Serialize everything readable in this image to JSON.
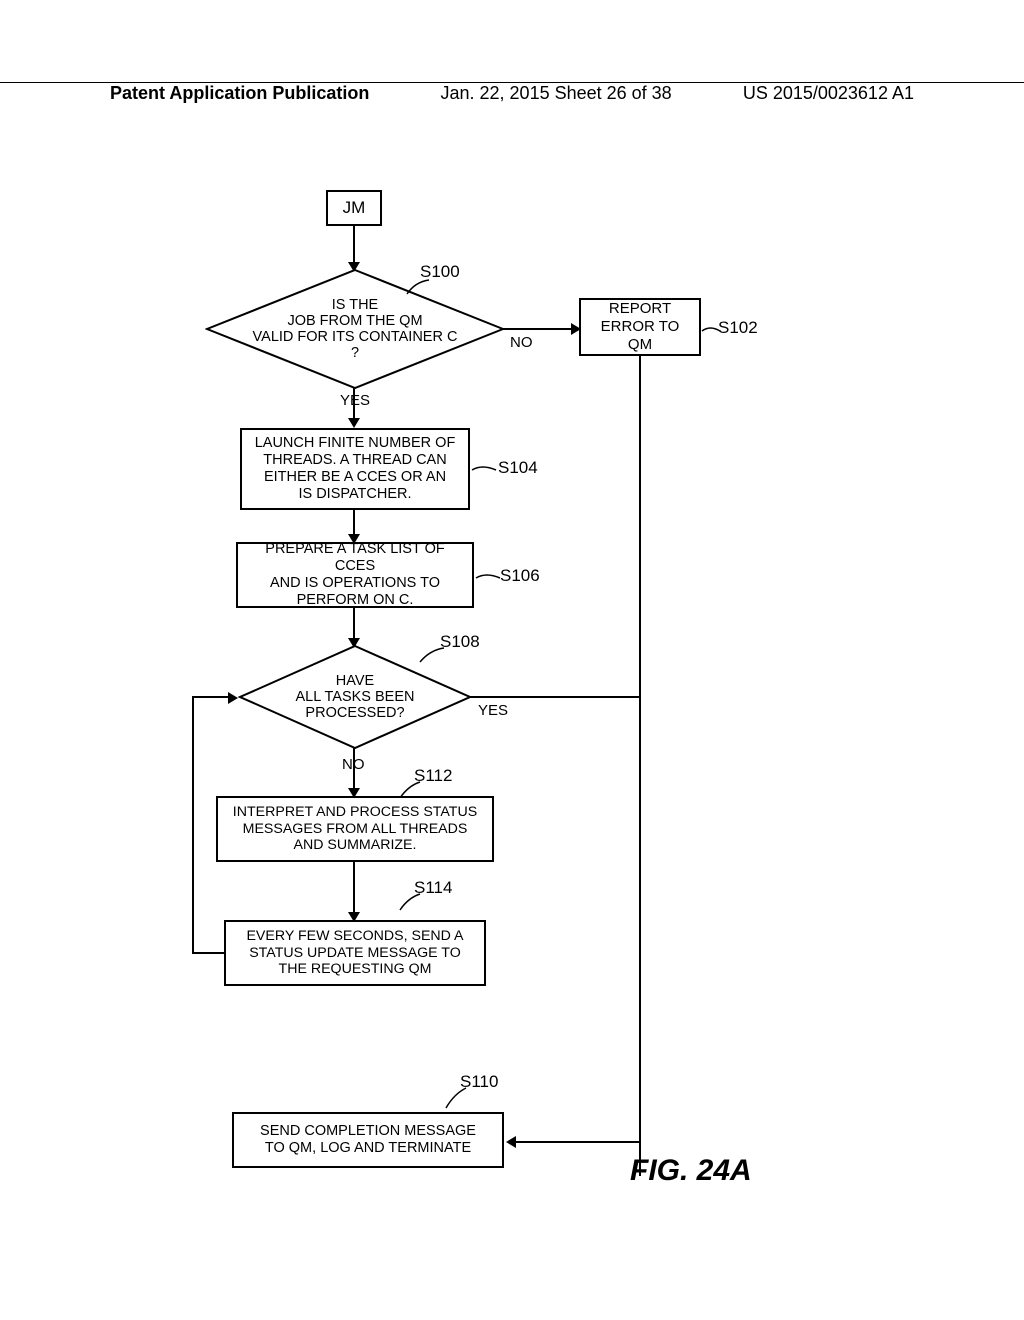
{
  "header": {
    "left": "Patent Application Publication",
    "mid": "Jan. 22, 2015  Sheet 26 of 38",
    "right": "US 2015/0023612 A1"
  },
  "figure_title": "FIG. 24A",
  "nodes": {
    "jm": "JM",
    "d1": "IS THE\nJOB FROM THE QM\nVALID FOR ITS CONTAINER C\n?",
    "report_error": "REPORT\nERROR TO QM",
    "launch_threads": "LAUNCH FINITE NUMBER OF\nTHREADS. A THREAD CAN\nEITHER BE A CCES OR AN\nIS DISPATCHER.",
    "prepare_tasks": "PREPARE A TASK LIST OF CCES\nAND IS OPERATIONS TO\nPERFORM ON C.",
    "d2": "HAVE\nALL TASKS BEEN\nPROCESSED?",
    "interpret": "INTERPRET AND PROCESS STATUS\nMESSAGES FROM ALL THREADS\nAND SUMMARIZE.",
    "status_update": "EVERY FEW SECONDS, SEND A\nSTATUS UPDATE MESSAGE TO\nTHE REQUESTING QM",
    "completion": "SEND COMPLETION MESSAGE\nTO QM, LOG AND TERMINATE"
  },
  "labels": {
    "yes": "YES",
    "no": "NO"
  },
  "steps": {
    "s100": "S100",
    "s102": "S102",
    "s104": "S104",
    "s106": "S106",
    "s108": "S108",
    "s110": "S110",
    "s112": "S112",
    "s114": "S114"
  }
}
